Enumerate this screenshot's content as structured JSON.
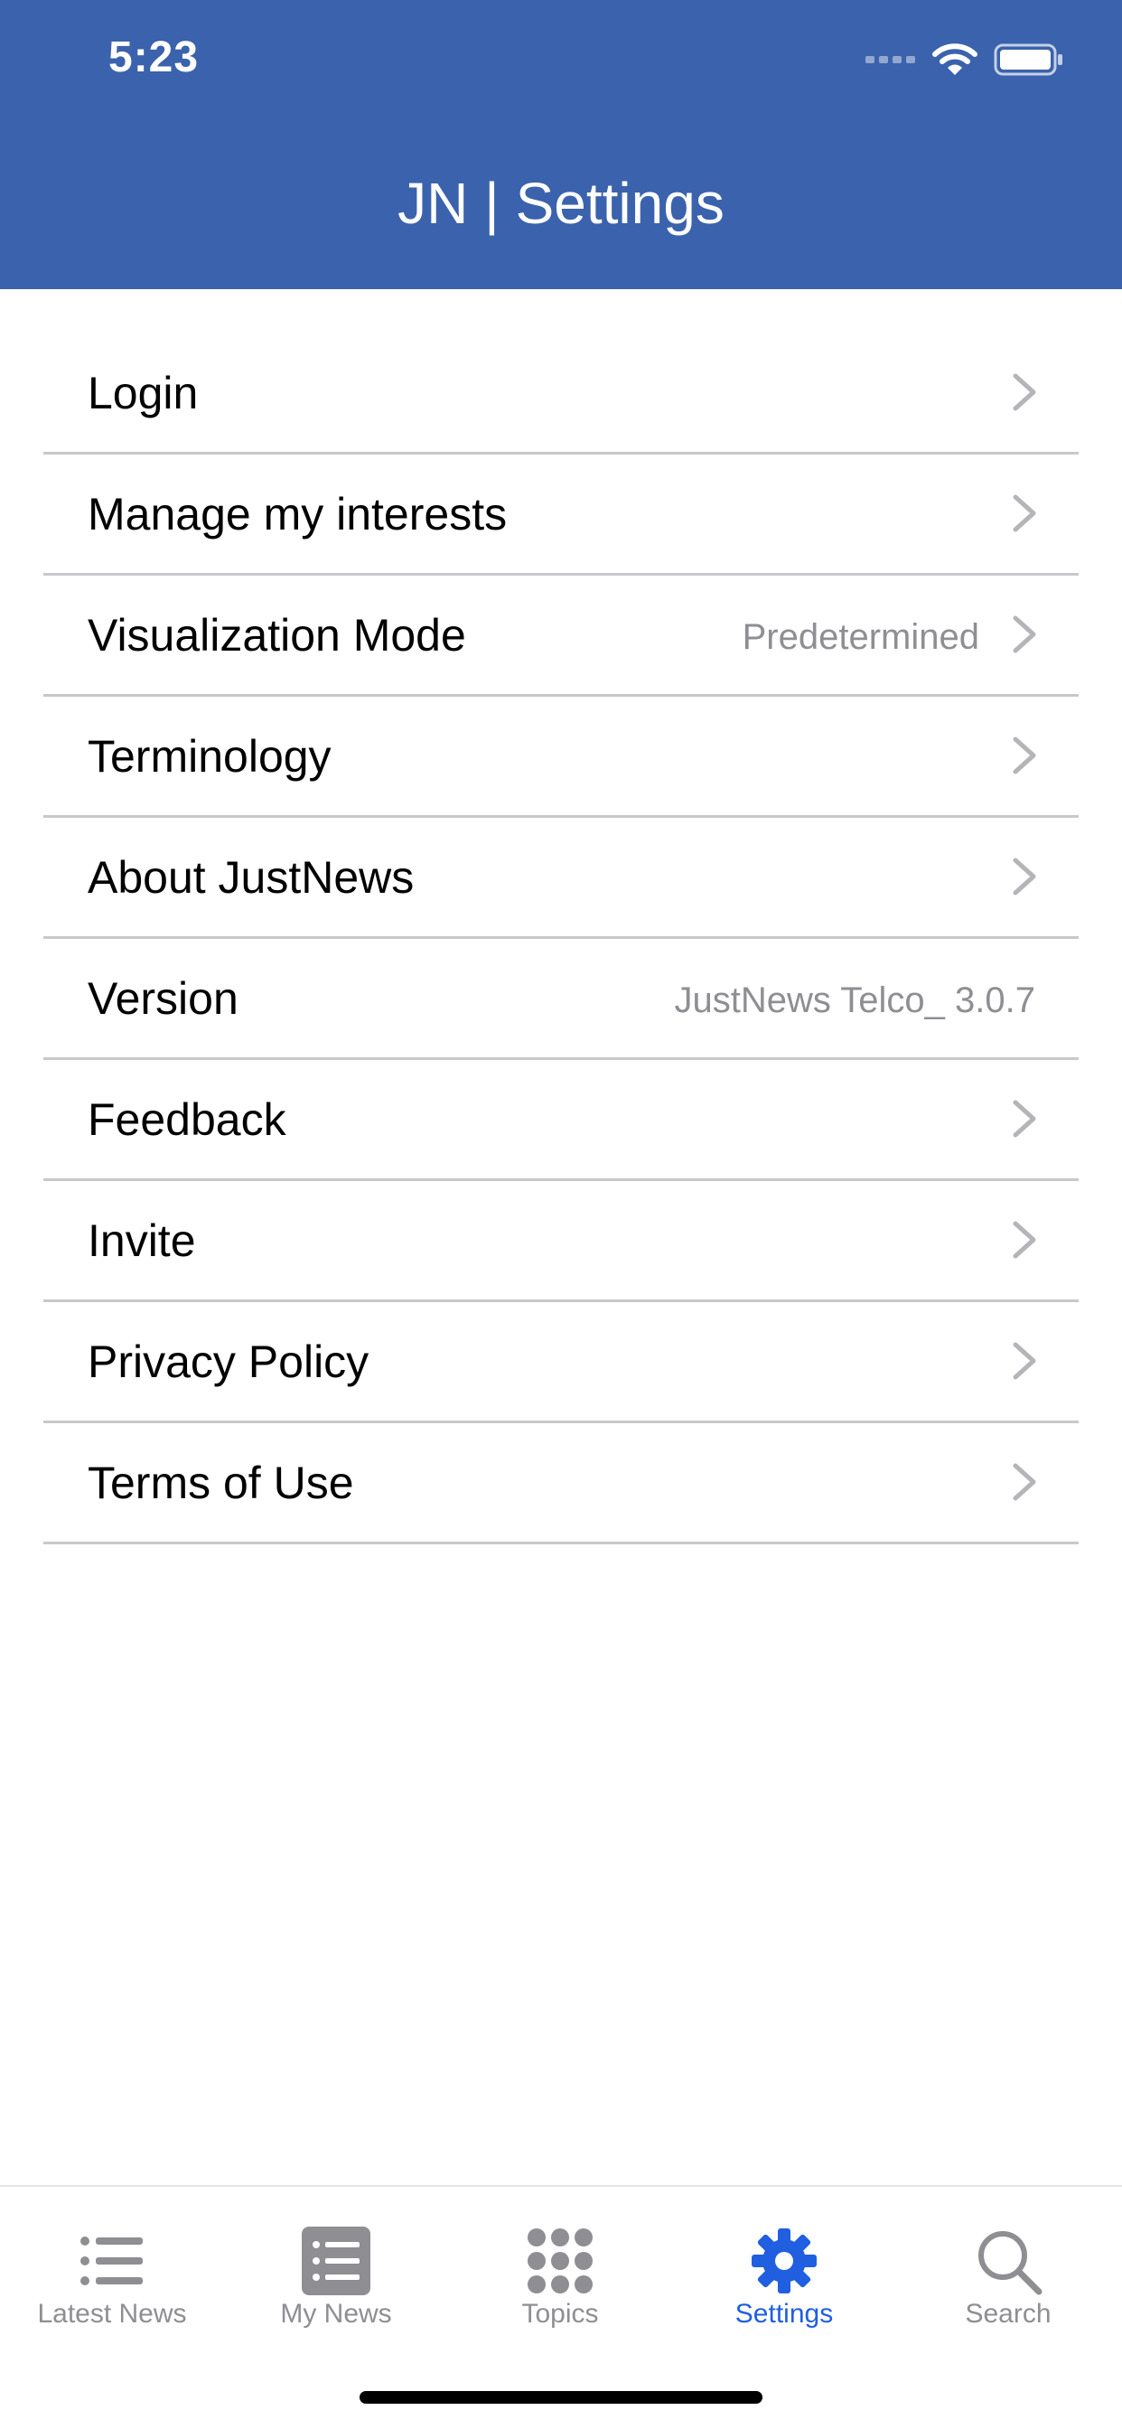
{
  "status_bar": {
    "time": "5:23"
  },
  "header": {
    "title": "JN | Settings",
    "background": "#3b62ac"
  },
  "settings": [
    {
      "label": "Login",
      "value": "",
      "chevron": true
    },
    {
      "label": "Manage my interests",
      "value": "",
      "chevron": true
    },
    {
      "label": "Visualization Mode",
      "value": "Predetermined",
      "chevron": true
    },
    {
      "label": "Terminology",
      "value": "",
      "chevron": true
    },
    {
      "label": "About JustNews",
      "value": "",
      "chevron": true
    },
    {
      "label": "Version",
      "value": "JustNews Telco_ 3.0.7",
      "chevron": false
    },
    {
      "label": "Feedback",
      "value": "",
      "chevron": true
    },
    {
      "label": "Invite",
      "value": "",
      "chevron": true
    },
    {
      "label": "Privacy Policy",
      "value": "",
      "chevron": true
    },
    {
      "label": "Terms of Use",
      "value": "",
      "chevron": true
    }
  ],
  "tabbar": {
    "active_color": "#1f5fe0",
    "inactive_color": "#8e8e93",
    "tabs": [
      {
        "label": "Latest News",
        "icon": "list-icon",
        "active": false
      },
      {
        "label": "My News",
        "icon": "list-box-icon",
        "active": false
      },
      {
        "label": "Topics",
        "icon": "grid-dots-icon",
        "active": false
      },
      {
        "label": "Settings",
        "icon": "gear-icon",
        "active": true
      },
      {
        "label": "Search",
        "icon": "search-icon",
        "active": false
      }
    ]
  }
}
